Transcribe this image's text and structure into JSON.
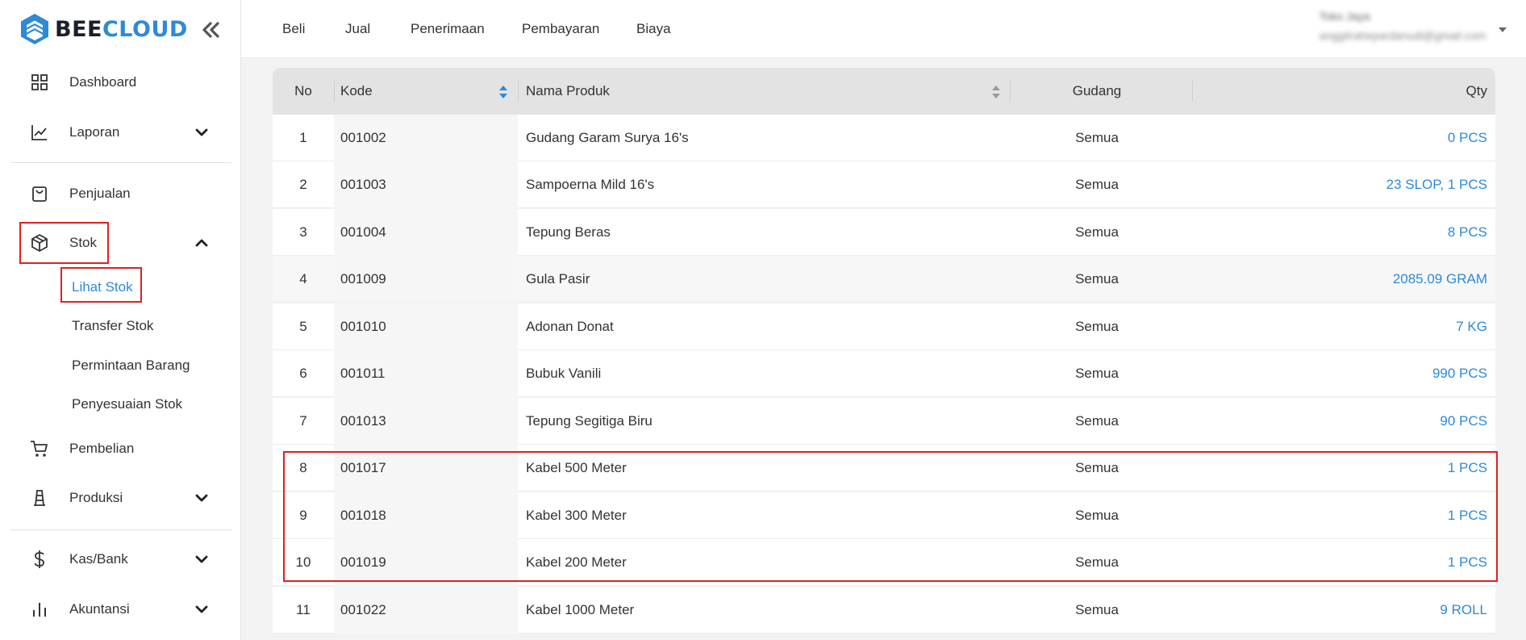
{
  "brand": {
    "part1": "BEE",
    "part2": "CLOUD"
  },
  "sidebar": {
    "items": [
      {
        "label": "Dashboard"
      },
      {
        "label": "Laporan"
      },
      {
        "label": "Penjualan"
      },
      {
        "label": "Stok"
      },
      {
        "label": "Pembelian"
      },
      {
        "label": "Produksi"
      },
      {
        "label": "Kas/Bank"
      },
      {
        "label": "Akuntansi"
      }
    ],
    "stok_sub": [
      {
        "label": "Lihat Stok"
      },
      {
        "label": "Transfer Stok"
      },
      {
        "label": "Permintaan Barang"
      },
      {
        "label": "Penyesuaian Stok"
      }
    ]
  },
  "topnav": [
    {
      "label": "Beli"
    },
    {
      "label": "Jual"
    },
    {
      "label": "Penerimaan"
    },
    {
      "label": "Pembayaran"
    },
    {
      "label": "Biaya"
    }
  ],
  "user": {
    "name": "Toko Jaya",
    "email": "anggitrahepardanudi@gmail.com"
  },
  "table": {
    "headers": {
      "no": "No",
      "kode": "Kode",
      "nama": "Nama Produk",
      "gudang": "Gudang",
      "qty": "Qty"
    },
    "rows": [
      {
        "no": "1",
        "kode": "001002",
        "nama": "Gudang Garam Surya 16's",
        "gudang": "Semua",
        "qty": "0 PCS"
      },
      {
        "no": "2",
        "kode": "001003",
        "nama": "Sampoerna Mild 16's",
        "gudang": "Semua",
        "qty": "23 SLOP, 1 PCS"
      },
      {
        "no": "3",
        "kode": "001004",
        "nama": "Tepung Beras",
        "gudang": "Semua",
        "qty": "8 PCS"
      },
      {
        "no": "4",
        "kode": "001009",
        "nama": "Gula Pasir",
        "gudang": "Semua",
        "qty": "2085.09 GRAM"
      },
      {
        "no": "5",
        "kode": "001010",
        "nama": "Adonan Donat",
        "gudang": "Semua",
        "qty": "7 KG"
      },
      {
        "no": "6",
        "kode": "001011",
        "nama": "Bubuk Vanili",
        "gudang": "Semua",
        "qty": "990 PCS"
      },
      {
        "no": "7",
        "kode": "001013",
        "nama": "Tepung Segitiga Biru",
        "gudang": "Semua",
        "qty": "90 PCS"
      },
      {
        "no": "8",
        "kode": "001017",
        "nama": "Kabel 500 Meter",
        "gudang": "Semua",
        "qty": "1 PCS"
      },
      {
        "no": "9",
        "kode": "001018",
        "nama": "Kabel 300 Meter",
        "gudang": "Semua",
        "qty": "1 PCS"
      },
      {
        "no": "10",
        "kode": "001019",
        "nama": "Kabel 200 Meter",
        "gudang": "Semua",
        "qty": "1 PCS"
      },
      {
        "no": "11",
        "kode": "001022",
        "nama": "Kabel 1000 Meter",
        "gudang": "Semua",
        "qty": "9 ROLL"
      }
    ]
  },
  "colors": {
    "accent": "#2d8ad8",
    "highlight": "#e02020",
    "header_bg": "#e3e3e3"
  }
}
